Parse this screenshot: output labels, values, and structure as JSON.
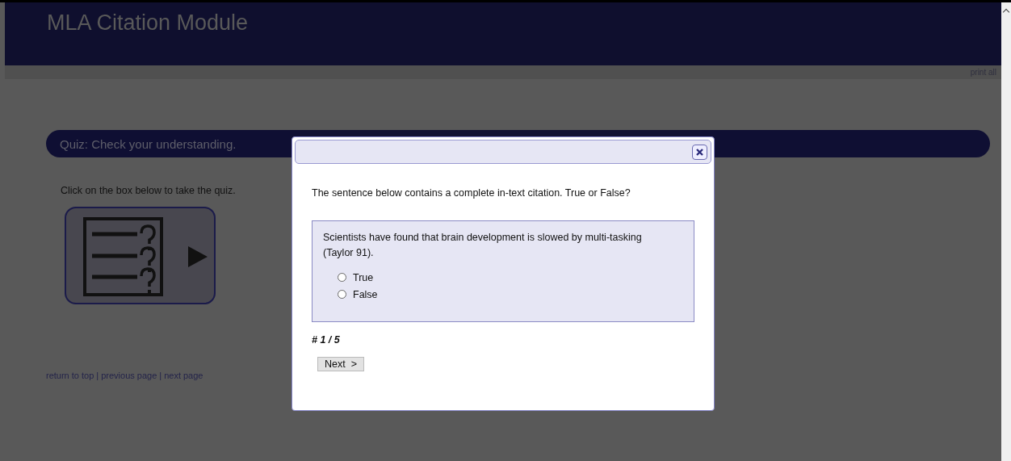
{
  "header": {
    "title": "MLA Citation Module"
  },
  "toolbar": {
    "print_link": "print all"
  },
  "section": {
    "heading": "Quiz: Check your understanding.",
    "instruction": "Click on the box below to take the quiz."
  },
  "footer_links": [
    {
      "label": "return to top"
    },
    {
      "label": "previous page"
    },
    {
      "label": "next page"
    }
  ],
  "footer_separator": "|",
  "dialog": {
    "question": "The sentence below contains a complete in-text citation. True or False?",
    "sentence": "Scientists have found that brain development is slowed by multi-tasking (Taylor 91).",
    "options": [
      {
        "label": "True",
        "selected": false
      },
      {
        "label": "False",
        "selected": false
      }
    ],
    "progress": "# 1 / 5",
    "next_button": "Next  >"
  }
}
